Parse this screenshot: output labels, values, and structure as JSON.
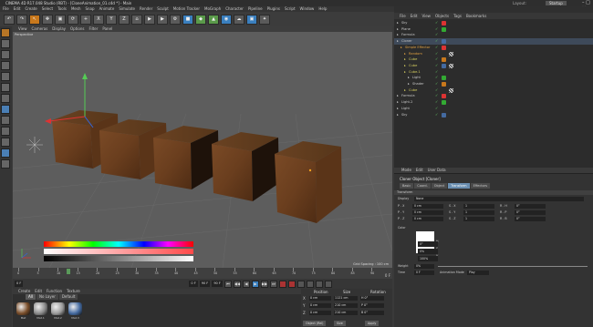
{
  "window": {
    "title": "CINEMA 4D R17.048 Studio (RBT) - [CloneAnimation_01.c4d *] - Main"
  },
  "menu": [
    "File",
    "Edit",
    "Create",
    "Select",
    "Tools",
    "Mesh",
    "Snap",
    "Animate",
    "Simulate",
    "Render",
    "Sculpt",
    "Motion Tracker",
    "MoGraph",
    "Character",
    "Pipeline",
    "Plugins",
    "Script",
    "Window",
    "Help"
  ],
  "layout": {
    "label": "Layout:",
    "value": "Startup"
  },
  "toolbar": {
    "undo": "↶",
    "redo": "↷",
    "live": "↖",
    "move": "✥",
    "scale": "▣",
    "rotate": "⟳",
    "add": "+",
    "x": "X",
    "y": "Y",
    "z": "Z",
    "world": "⌂"
  },
  "viewport": {
    "menu": [
      "View",
      "Cameras",
      "Display",
      "Options",
      "Filter",
      "Panel"
    ],
    "label": "Perspective",
    "grid_spacing": "Grid Spacing : 100 cm"
  },
  "timeline": {
    "ticks": [
      "0",
      "5",
      "10",
      "15",
      "20",
      "25",
      "30",
      "35",
      "40",
      "45",
      "50",
      "55",
      "60",
      "65",
      "70",
      "75",
      "80",
      "85",
      "90"
    ],
    "end_label": "0 F",
    "current_frame": "0 F",
    "start_field": "0 F",
    "end_field": "90 F",
    "end2_field": "90 F"
  },
  "transport": {
    "buttons": [
      "⏮",
      "◀◀",
      "◀",
      "▶",
      "▶▶",
      "⏭"
    ]
  },
  "material": {
    "menu": [
      "Create",
      "Edit",
      "Function",
      "Texture"
    ],
    "tabs": [
      "All",
      "No Layer",
      "Default"
    ],
    "swatches": [
      {
        "label": "Mat",
        "color": "#7a4e2a"
      },
      {
        "label": "Mat.1",
        "color": "#8a8a8a"
      },
      {
        "label": "Mat.2",
        "color": "#9a9a9a"
      },
      {
        "label": "Mat.3",
        "color": "#446aa0"
      }
    ]
  },
  "coords": {
    "headers": [
      "Position",
      "Size",
      "Rotation"
    ],
    "rows": [
      {
        "axis": "X",
        "pos": "0 cm",
        "size": "1121 cm",
        "rot": "H  0°"
      },
      {
        "axis": "Y",
        "pos": "0 cm",
        "size": "210 cm",
        "rot": "P  0°"
      },
      {
        "axis": "Z",
        "pos": "0 cm",
        "size": "210 cm",
        "rot": "B  0°"
      }
    ],
    "mode": "Object (Rel)",
    "size_mode": "Size",
    "apply": "Apply"
  },
  "objects": {
    "menu": [
      "File",
      "Edit",
      "View",
      "Objects",
      "Tags",
      "Bookmarks"
    ],
    "items": [
      {
        "name": "Sky",
        "indent": 0,
        "color": "#c8c8c8"
      },
      {
        "name": "Plane",
        "indent": 0,
        "color": "#c8c8c8"
      },
      {
        "name": "Formula",
        "indent": 0,
        "color": "#c8c8c8"
      },
      {
        "name": "Cloner",
        "indent": 0,
        "color": "#c8c8c8"
      },
      {
        "name": "Simple Effector",
        "indent": 1,
        "color": "#e0a040"
      },
      {
        "name": "Random",
        "indent": 2,
        "color": "#e0a040"
      },
      {
        "name": "Cube",
        "indent": 2,
        "color": "#d8d060"
      },
      {
        "name": "Cube",
        "indent": 2,
        "color": "#d8d060"
      },
      {
        "name": "Cube.1",
        "indent": 2,
        "color": "#d8d060"
      },
      {
        "name": "Light",
        "indent": 3,
        "color": "#c8c8c8"
      },
      {
        "name": "Shader",
        "indent": 3,
        "color": "#c8c8c8"
      },
      {
        "name": "Cube",
        "indent": 2,
        "color": "#d8d060"
      },
      {
        "name": "Formula",
        "indent": 0,
        "color": "#c8c8c8"
      },
      {
        "name": "Light.2",
        "indent": 0,
        "color": "#c8c8c8"
      },
      {
        "name": "Light",
        "indent": 0,
        "color": "#c8c8c8"
      },
      {
        "name": "Sky",
        "indent": 0,
        "color": "#c8c8c8"
      }
    ]
  },
  "attributes": {
    "menu": [
      "Mode",
      "Edit",
      "User Data"
    ],
    "title": "Cloner Object [Cloner]",
    "tabs": [
      "Basic",
      "Coord.",
      "Object",
      "Transform",
      "Effectors"
    ],
    "active_tab": "Transform",
    "section": "Transform",
    "display_label": "Display",
    "display_value": "None",
    "pos_rows": [
      {
        "label": "P . X",
        "val": "0 cm",
        "s": "S . X",
        "sv": "1",
        "r": "R . H",
        "rv": "0°"
      },
      {
        "label": "P . Y",
        "val": "0 cm",
        "s": "S . Y",
        "sv": "1",
        "r": "R . P",
        "rv": "0°"
      },
      {
        "label": "P . Z",
        "val": "0 cm",
        "s": "S . Z",
        "sv": "1",
        "r": "R . B",
        "rv": "0°"
      }
    ],
    "color_label": "Color",
    "hsv": [
      {
        "label": "H",
        "val": "0°"
      },
      {
        "label": "S",
        "val": "0%"
      },
      {
        "label": "V",
        "val": "100%"
      }
    ],
    "weight_label": "Weight",
    "weight_value": "0%",
    "time_label": "Time",
    "time_value": "0 F",
    "anim_label": "Animation Mode",
    "anim_value": "Play"
  }
}
